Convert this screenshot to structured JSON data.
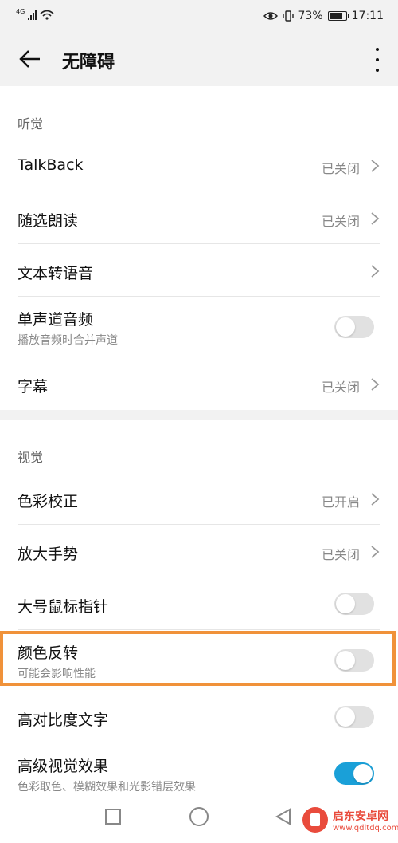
{
  "status_bar": {
    "network": "4G",
    "battery": "73%",
    "time": "17:11"
  },
  "header": {
    "title": "无障碍"
  },
  "sections": {
    "hearing": {
      "title": "听觉",
      "items": [
        {
          "label": "TalkBack",
          "value": "已关闭"
        },
        {
          "label": "随选朗读",
          "value": "已关闭"
        },
        {
          "label": "文本转语音"
        },
        {
          "label": "单声道音频",
          "sub": "播放音频时合并声道",
          "toggle": "off"
        },
        {
          "label": "字幕",
          "value": "已关闭"
        }
      ]
    },
    "vision": {
      "title": "视觉",
      "items": [
        {
          "label": "色彩校正",
          "value": "已开启"
        },
        {
          "label": "放大手势",
          "value": "已关闭"
        },
        {
          "label": "大号鼠标指针",
          "toggle": "off"
        },
        {
          "label": "颜色反转",
          "sub": "可能会影响性能",
          "toggle": "off"
        },
        {
          "label": "高对比度文字",
          "toggle": "off"
        },
        {
          "label": "高级视觉效果",
          "sub": "色彩取色、模糊效果和光影错层效果",
          "toggle": "on"
        }
      ]
    }
  },
  "watermark": {
    "title": "启东安卓网",
    "url": "www.qdltdq.com"
  },
  "colors": {
    "accent": "#1aa0d8",
    "highlight": "#f0923a",
    "background": "#f2f2f2"
  }
}
